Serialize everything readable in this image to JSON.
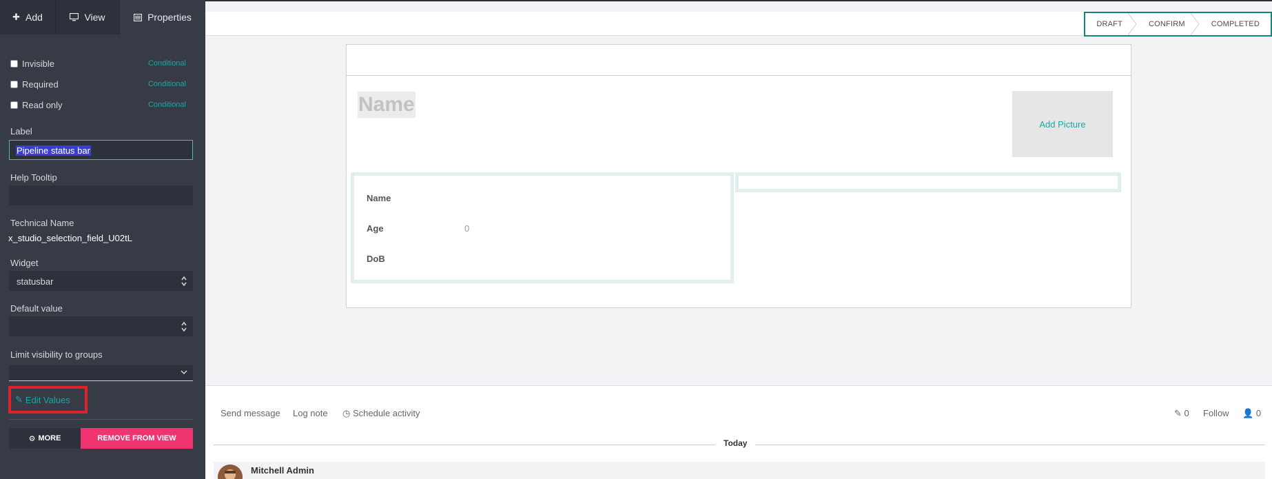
{
  "sidebar": {
    "tabs": {
      "add": "Add",
      "view": "View",
      "properties": "Properties"
    },
    "checks": {
      "invisible": "Invisible",
      "required": "Required",
      "readonly": "Read only",
      "conditional": "Conditional"
    },
    "label_caption": "Label",
    "label_value": "Pipeline status bar",
    "tooltip_caption": "Help Tooltip",
    "technical_caption": "Technical Name",
    "technical_value": "x_studio_selection_field_U02tL",
    "widget_caption": "Widget",
    "widget_value": "statusbar",
    "default_caption": "Default value",
    "groups_caption": "Limit visibility to groups",
    "edit_values": "Edit Values",
    "more": "MORE",
    "remove": "REMOVE FROM VIEW"
  },
  "statusbar": {
    "stages": [
      "DRAFT",
      "CONFIRM",
      "COMPLETED"
    ]
  },
  "form": {
    "title_placeholder": "Name",
    "add_picture": "Add Picture",
    "fields": {
      "name_label": "Name",
      "age_label": "Age",
      "age_value": "0",
      "dob_label": "DoB"
    }
  },
  "chatter": {
    "send_message": "Send message",
    "log_note": "Log note",
    "schedule_activity": "Schedule activity",
    "attachments_count": "0",
    "follow": "Follow",
    "followers_count": "0",
    "today": "Today",
    "author": "Mitchell Admin"
  },
  "colors": {
    "accent": "#1ba8a4",
    "danger": "#f0346f",
    "highlight_box": "#e0222a",
    "sidebar_bg": "#373b46"
  }
}
